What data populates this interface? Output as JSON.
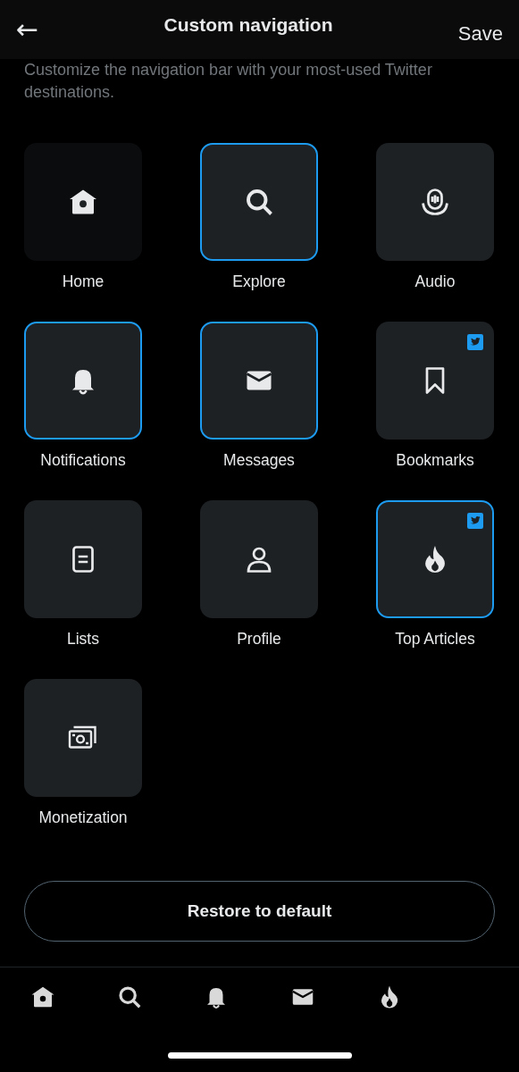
{
  "header": {
    "back": "←",
    "title": "Custom navigation",
    "save": "Save"
  },
  "description": "Customize the navigation bar with your most-used Twitter destinations.",
  "tiles": [
    {
      "label": "Home",
      "kind": "home",
      "selected": false,
      "locked": true,
      "premium": false
    },
    {
      "label": "Explore",
      "kind": "search",
      "selected": true,
      "locked": false,
      "premium": false
    },
    {
      "label": "Audio",
      "kind": "audio",
      "selected": false,
      "locked": false,
      "premium": false
    },
    {
      "label": "Notifications",
      "kind": "bell",
      "selected": true,
      "locked": false,
      "premium": false
    },
    {
      "label": "Messages",
      "kind": "mail",
      "selected": true,
      "locked": false,
      "premium": false
    },
    {
      "label": "Bookmarks",
      "kind": "bookmark",
      "selected": false,
      "locked": false,
      "premium": true
    },
    {
      "label": "Lists",
      "kind": "list",
      "selected": false,
      "locked": false,
      "premium": false
    },
    {
      "label": "Profile",
      "kind": "person",
      "selected": false,
      "locked": false,
      "premium": false
    },
    {
      "label": "Top Articles",
      "kind": "flame",
      "selected": true,
      "locked": false,
      "premium": true
    },
    {
      "label": "Monetization",
      "kind": "money",
      "selected": false,
      "locked": false,
      "premium": false
    }
  ],
  "restore_button": "Restore to default",
  "bottom_nav": [
    {
      "kind": "home"
    },
    {
      "kind": "search"
    },
    {
      "kind": "bell"
    },
    {
      "kind": "mail"
    },
    {
      "kind": "flame"
    }
  ]
}
